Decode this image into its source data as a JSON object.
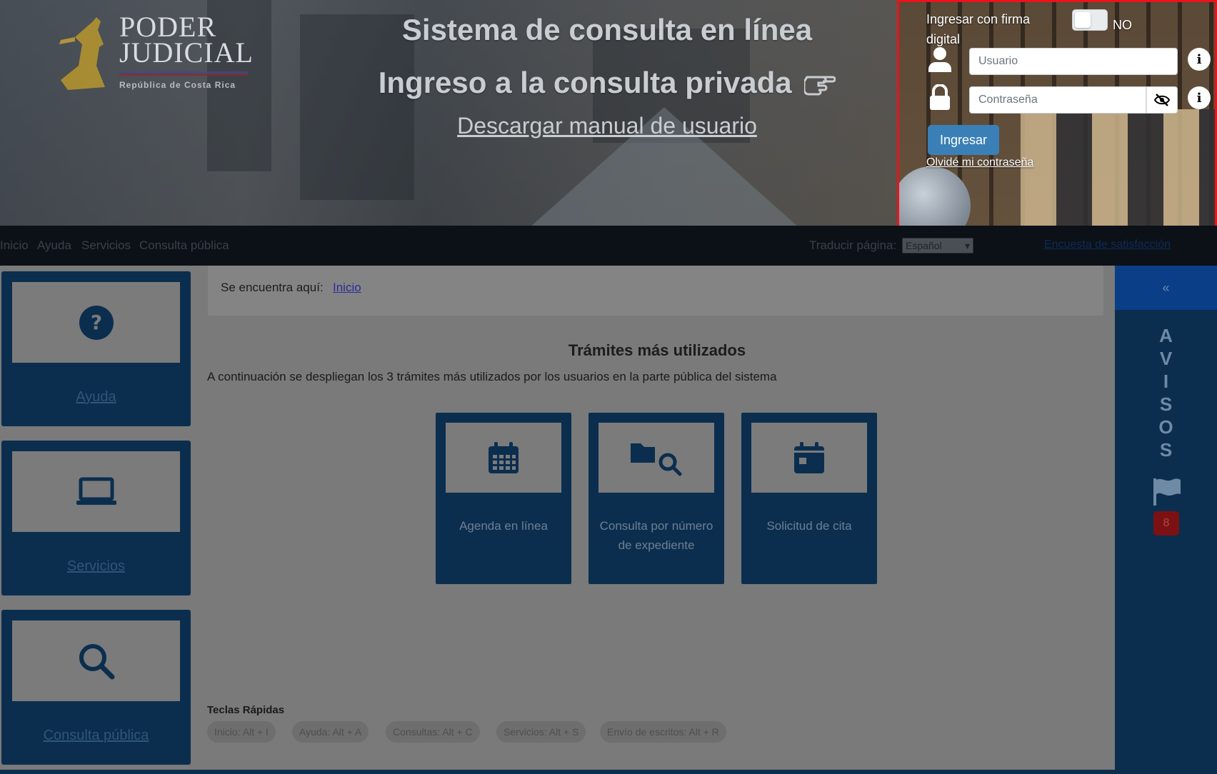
{
  "header": {
    "logo": {
      "word_line1": "PODER",
      "word_line2": "JUDICIAL",
      "subtitle": "República de Costa Rica"
    },
    "title_line1": "Sistema de consulta en línea",
    "title_line2": "Ingreso a la consulta privada",
    "manual_link": "Descargar manual de usuario"
  },
  "login": {
    "digital_signature_label": "Ingresar con firma digital",
    "toggle_state": "NO",
    "username_placeholder": "Usuario",
    "password_placeholder": "Contraseña",
    "submit_label": "Ingresar",
    "forgot_password_label": "Olvidé mi contraseña",
    "info_icon": "i",
    "highlight_color": "#e8141a",
    "button_color": "#3a80b6"
  },
  "navbar": {
    "items": [
      "Inicio",
      "Ayuda",
      "Servicios",
      "Consulta pública"
    ],
    "translate_label": "Traducir página:",
    "language_selected": "Español",
    "survey_link": "Encuesta de satisfacción"
  },
  "sidebar": {
    "cards": [
      {
        "label": "Ayuda",
        "icon": "question-circle-icon"
      },
      {
        "label": "Servicios",
        "icon": "laptop-icon"
      },
      {
        "label": "Consulta pública",
        "icon": "search-icon"
      }
    ]
  },
  "breadcrumb": {
    "prefix": "Se encuentra aquí:",
    "current": "Inicio"
  },
  "main": {
    "section_title": "Trámites más utilizados",
    "section_subtitle": "A continuación se despliegan los 3 trámites más utilizados por los usuarios en la parte pública del sistema",
    "tiles": [
      {
        "label": "Agenda en línea",
        "icon": "calendar-grid-icon"
      },
      {
        "label": "Consulta por número de expediente",
        "icon": "folder-search-icon"
      },
      {
        "label": "Solicitud de cita",
        "icon": "calendar-icon"
      }
    ],
    "shortcuts_title": "Teclas Rápidas",
    "shortcuts": [
      "Inicio: Alt + I",
      "Ayuda: Alt + A",
      "Consultas: Alt + C",
      "Servicios: Alt + S",
      "Envío de escritos: Alt + R"
    ]
  },
  "avisos": {
    "collapse_label": "«",
    "title_letters": [
      "A",
      "V",
      "I",
      "S",
      "O",
      "S"
    ],
    "badge_count": "8"
  }
}
